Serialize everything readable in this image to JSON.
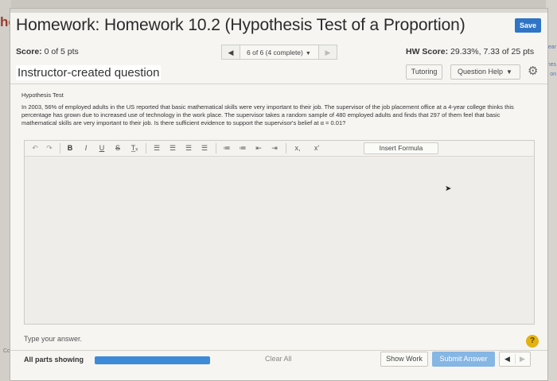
{
  "background": {
    "left_fragment": "he",
    "bottom_left_fragment": "Com",
    "right_fragments": [
      "ear",
      "nes",
      "on"
    ]
  },
  "header": {
    "title": "Homework: Homework 10.2 (Hypothesis Test of a Proportion)",
    "save_label": "Save"
  },
  "status": {
    "score_label": "Score:",
    "score_value": "0 of 5 pts",
    "nav_prev": "◀",
    "nav_select": "6 of 6 (4 complete)",
    "nav_next": "▶",
    "hw_score_label": "HW Score:",
    "hw_score_value": "29.33%, 7.33 of 25 pts"
  },
  "question_bar": {
    "title": "Instructor-created question",
    "tutoring": "Tutoring",
    "question_help": "Question Help"
  },
  "question": {
    "label": "Hypothesis Test",
    "text": "In 2003, 56% of employed adults in the US reported that basic mathematical skills were very important to their job. The supervisor of the job placement office at a 4-year college thinks this percentage has grown due to increased use of technology in the work place. The supervisor takes a random sample of 480 employed adults and finds that 297 of them feel that basic mathematical skills are very important to their job. Is there sufficient evidence to support the supervisor's belief at α = 0.01?"
  },
  "editor": {
    "undo": "↶",
    "redo": "↷",
    "bold": "B",
    "italic": "I",
    "underline": "U",
    "strike": "S",
    "clear_format": "T̲ₓ",
    "subscript": "x,",
    "superscript": "x'",
    "insert_formula": "Insert Formula"
  },
  "answer": {
    "placeholder": "Type your answer.",
    "help": "?"
  },
  "footer": {
    "all_parts": "All parts showing",
    "progress": 1.0,
    "clear_all": "Clear All",
    "show_work": "Show Work",
    "submit": "Submit Answer",
    "prev": "◀",
    "next": "▶"
  },
  "colors": {
    "save_button": "#2f74c6",
    "progress_bar": "#3d8ad8",
    "submit_button": "#86b6e3",
    "help_icon": "#e3b20e"
  }
}
